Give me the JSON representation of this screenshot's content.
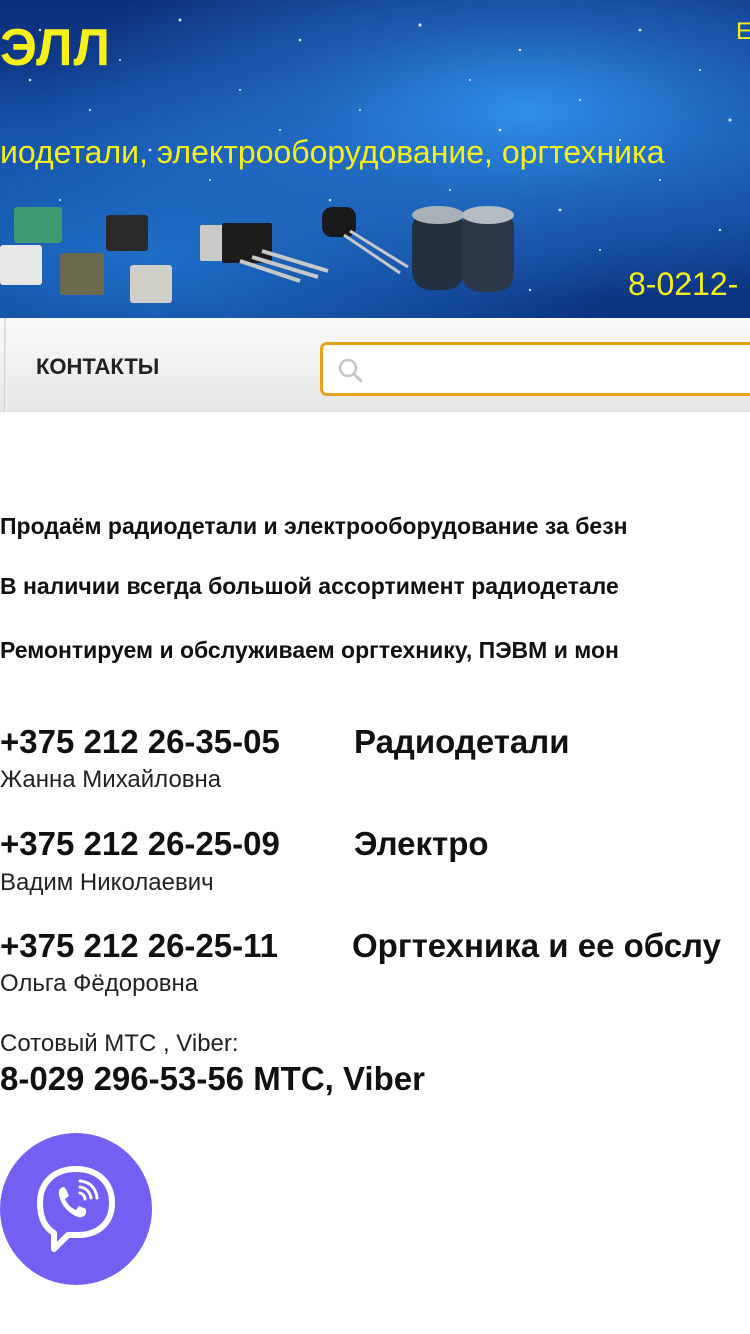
{
  "header": {
    "brand": "ЭЛЛ",
    "top_right": "E",
    "tagline": "иодетали, электрооборудование, оргтехника",
    "phone": "8-0212-"
  },
  "nav": {
    "contacts": "КОНТАКТЫ",
    "search_placeholder": ""
  },
  "intro": [
    "Продаём радиодетали и электрооборудование за безн",
    "В наличии всегда большой ассортимент радиодетале",
    "Ремонтируем и обслуживаем оргтехнику, ПЭВМ и мон"
  ],
  "contacts": [
    {
      "phone": "+375 212 26-35-05",
      "dept": "Радиодетали",
      "person": "Жанна Михайловна"
    },
    {
      "phone": "+375 212 26-25-09",
      "dept": "Электро",
      "person": "Вадим Николаевич"
    },
    {
      "phone": "+375 212 26-25-11",
      "dept": "Оргтехника и ее обслу",
      "person": "Ольга Фёдоровна"
    }
  ],
  "mobile": {
    "label": "Сотовый МТС , Viber:",
    "number": "8-029 296-53-56 МТС, Viber"
  },
  "icons": {
    "search": "search-icon",
    "viber": "viber-icon"
  },
  "colors": {
    "brand_yellow": "#f6ef1a",
    "search_border": "#e6a21c",
    "viber": "#7360f2"
  }
}
